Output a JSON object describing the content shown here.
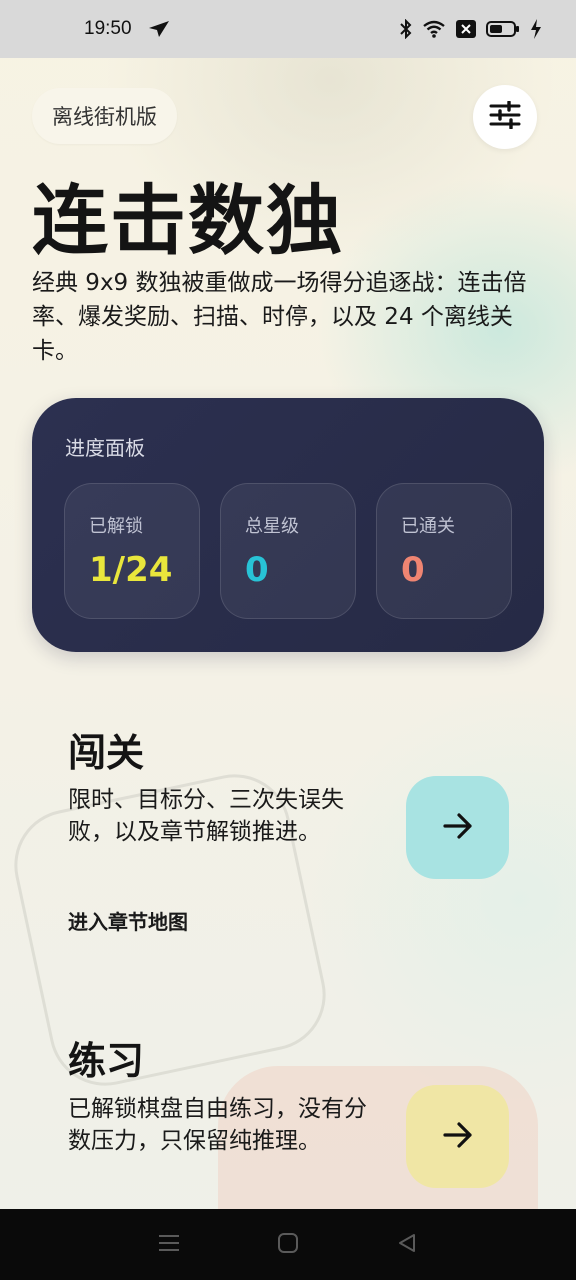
{
  "status_bar": {
    "time": "19:50",
    "icons": [
      "navigation-icon",
      "bluetooth-icon",
      "wifi-icon",
      "x-box-icon",
      "battery-icon",
      "charging-icon"
    ]
  },
  "header": {
    "badge": "离线街机版",
    "settings_icon": "sliders-icon"
  },
  "hero": {
    "title": "连击数独",
    "description": "经典 9x9 数独被重做成一场得分追逐战：连击倍率、爆发奖励、扫描、时停，以及 24 个离线关卡。"
  },
  "progress_panel": {
    "title": "进度面板",
    "stats": [
      {
        "label": "已解锁",
        "value": "1/24",
        "color": "#e9e63c"
      },
      {
        "label": "总星级",
        "value": "0",
        "color": "#28c3d6"
      },
      {
        "label": "已通关",
        "value": "0",
        "color": "#ef8572"
      }
    ]
  },
  "modes": [
    {
      "title": "闯关",
      "description": "限时、目标分、三次失误失败，以及章节解锁推进。",
      "link": "进入章节地图",
      "button_color": "#a8e3e2",
      "icon": "arrow-right-icon"
    },
    {
      "title": "练习",
      "description": "已解锁棋盘自由练习，没有分数压力，只保留纯推理。",
      "button_color": "#f0e6a5",
      "icon": "arrow-right-icon"
    }
  ],
  "nav_bar": {
    "icons": [
      "menu-icon",
      "home-icon",
      "back-icon"
    ]
  }
}
